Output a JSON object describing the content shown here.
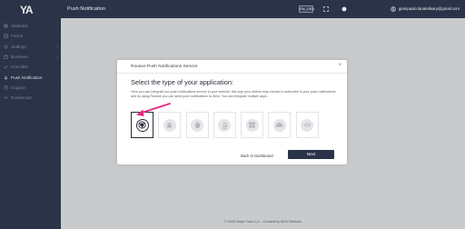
{
  "app": {
    "logo_text": "YA"
  },
  "sidebar": {
    "items": [
      {
        "label": "Websites",
        "icon": "globe-icon",
        "has_chevron": true
      },
      {
        "label": "Forms",
        "icon": "form-icon",
        "has_chevron": false
      },
      {
        "label": "Settings",
        "icon": "gear-icon",
        "has_chevron": true
      },
      {
        "label": "Business",
        "icon": "briefcase-icon",
        "has_chevron": true
      },
      {
        "label": "Checklist",
        "icon": "check-icon",
        "has_chevron": false
      },
      {
        "label": "Push Notification",
        "icon": "bell-icon",
        "has_chevron": false,
        "active": true
      },
      {
        "label": "Support",
        "icon": "question-icon",
        "has_chevron": true
      },
      {
        "label": "Roulsecast",
        "icon": "broadcast-icon",
        "has_chevron": false
      }
    ]
  },
  "header": {
    "title": "Push Notification",
    "language": "EN_USA",
    "user_email": "giampaolo.lanatelleary@gmail.com"
  },
  "modal": {
    "title": "Rousee Push Notifications Service",
    "close_symbol": "×",
    "heading": "Select the type of your application:",
    "description": "Here you can integrate our push notifications service to your website, this way your visitors may choose to subscribe to your push notifications and by using Rousee you can send push notifications to them. You can integrate multiple apps.",
    "app_types": [
      {
        "name": "chrome-icon",
        "selected": true
      },
      {
        "name": "android-icon",
        "selected": false
      },
      {
        "name": "apple-icon",
        "selected": false
      },
      {
        "name": "amazon-icon",
        "selected": false
      },
      {
        "name": "windows-icon",
        "selected": false
      },
      {
        "name": "cloud-icon",
        "selected": false
      },
      {
        "name": "code-icon",
        "selected": false
      }
    ],
    "back_label": "Back to Dashboard",
    "next_label": "Next"
  },
  "footer": {
    "text": "© 2020 Ways Yara LLC - Created by AMU Network"
  },
  "colors": {
    "sidebar": "#2b3348",
    "accent_arrow": "#e6287f",
    "background": "#c9cacc"
  }
}
